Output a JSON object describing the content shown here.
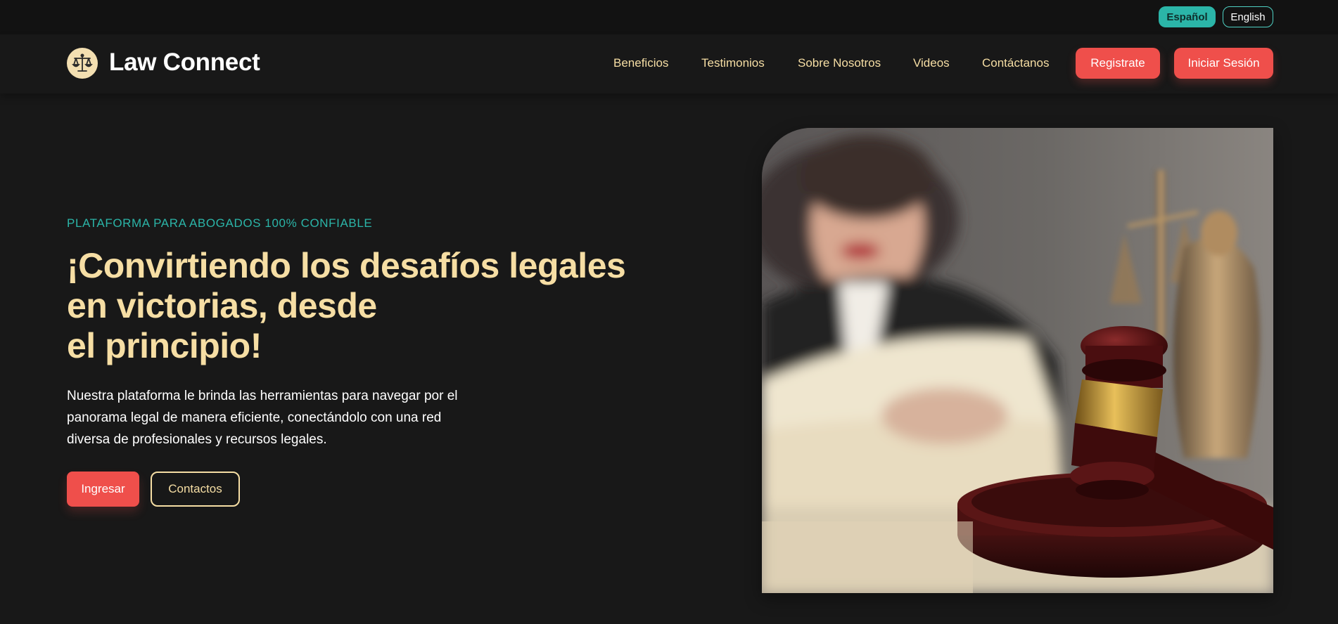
{
  "lang": {
    "spanish": "Español",
    "english": "English"
  },
  "brand": {
    "name": "Law Connect",
    "logo_icon": "scales-of-justice-icon"
  },
  "nav": {
    "links": [
      "Beneficios",
      "Testimonios",
      "Sobre Nosotros",
      "Videos",
      "Contáctanos"
    ],
    "register": "Registrate",
    "login": "Iniciar Sesión"
  },
  "hero": {
    "eyebrow": "PLATAFORMA PARA ABOGADOS 100% CONFIABLE",
    "headline": [
      "¡Convirtiendo los desafíos legales",
      "en victorias, desde",
      "el principio!"
    ],
    "description": [
      "Nuestra plataforma le brinda las herramientas para navegar por el",
      "panorama legal de manera eficiente, conectándolo con una red",
      "diversa de profesionales y recursos legales."
    ],
    "primary_button": "Ingresar",
    "secondary_button": "Contactos"
  },
  "colors": {
    "background": "#181818",
    "accent_teal": "#2bb5a8",
    "accent_cream": "#f6dea4",
    "accent_red": "#ef4f4b"
  }
}
